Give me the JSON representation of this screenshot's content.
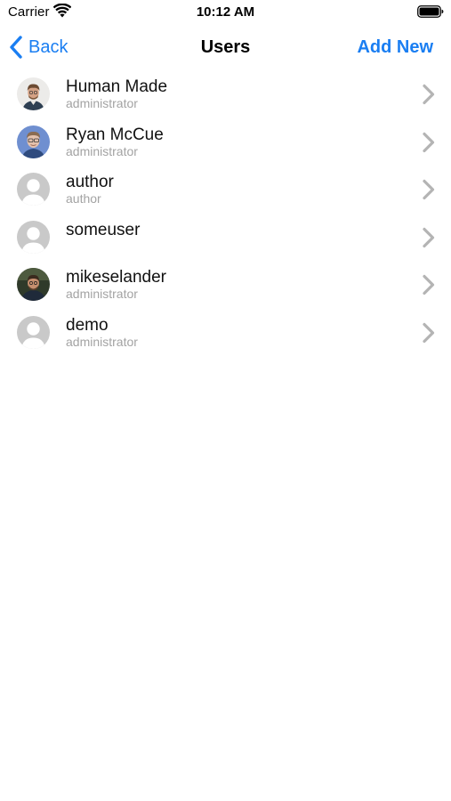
{
  "status_bar": {
    "carrier": "Carrier",
    "time": "10:12 AM"
  },
  "nav": {
    "back_label": "Back",
    "title": "Users",
    "add_label": "Add New"
  },
  "colors": {
    "accent": "#1a7ef2",
    "secondary_text": "#a3a3a3",
    "chevron": "#b4b4b4"
  },
  "users": [
    {
      "name": "Human Made",
      "role": "administrator",
      "avatar": "photo"
    },
    {
      "name": "Ryan McCue",
      "role": "administrator",
      "avatar": "photo"
    },
    {
      "name": "author",
      "role": "author",
      "avatar": "default-silhouette"
    },
    {
      "name": "someuser",
      "role": "",
      "avatar": "default-silhouette"
    },
    {
      "name": "mikeselander",
      "role": "administrator",
      "avatar": "photo"
    },
    {
      "name": "demo",
      "role": "administrator",
      "avatar": "default-silhouette"
    }
  ]
}
